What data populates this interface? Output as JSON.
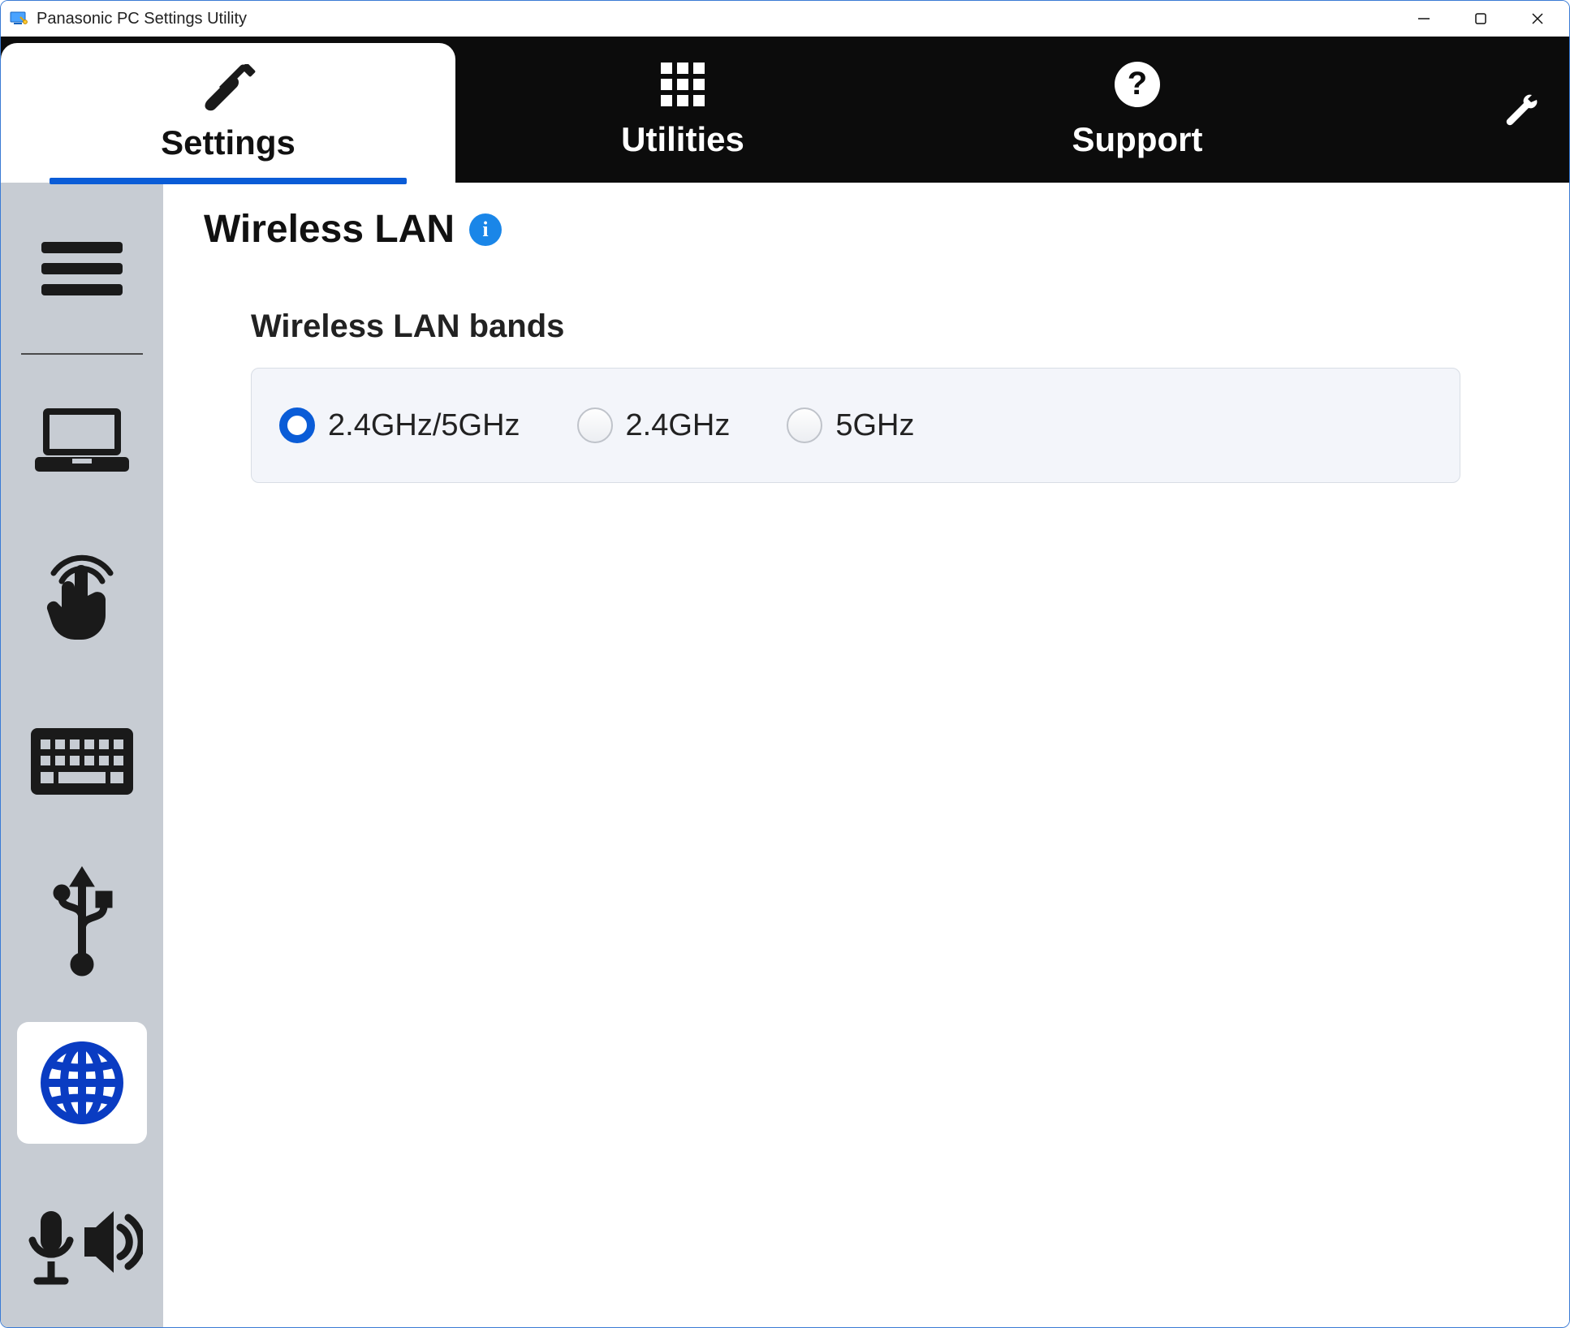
{
  "window": {
    "title": "Panasonic PC Settings Utility"
  },
  "tabs": {
    "settings": "Settings",
    "utilities": "Utilities",
    "support": "Support",
    "active": "settings"
  },
  "page": {
    "title": "Wireless LAN",
    "info_glyph": "i"
  },
  "section": {
    "title": "Wireless LAN bands",
    "options": [
      {
        "label": "2.4GHz/5GHz",
        "selected": true
      },
      {
        "label": "2.4GHz",
        "selected": false
      },
      {
        "label": "5GHz",
        "selected": false
      }
    ]
  },
  "sidebar": {
    "items": [
      {
        "name": "menu",
        "active": false
      },
      {
        "name": "display",
        "active": false
      },
      {
        "name": "touch",
        "active": false
      },
      {
        "name": "keyboard",
        "active": false
      },
      {
        "name": "usb",
        "active": false
      },
      {
        "name": "network",
        "active": true
      },
      {
        "name": "audio",
        "active": false
      }
    ]
  }
}
